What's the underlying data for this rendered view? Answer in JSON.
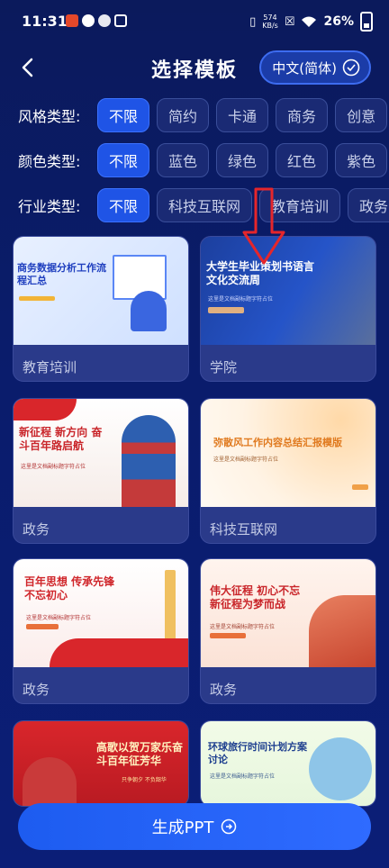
{
  "status": {
    "time": "11:31",
    "net_speed_value": "574",
    "net_speed_unit": "KB/s",
    "battery": "26%"
  },
  "header": {
    "title": "选择模板",
    "language": "中文(简体)"
  },
  "filters": [
    {
      "label": "风格类型:",
      "options": [
        "不限",
        "简约",
        "卡通",
        "商务",
        "创意"
      ],
      "selected": "不限"
    },
    {
      "label": "颜色类型:",
      "options": [
        "不限",
        "蓝色",
        "绿色",
        "红色",
        "紫色"
      ],
      "selected": "不限"
    },
    {
      "label": "行业类型:",
      "options": [
        "不限",
        "科技互联网",
        "教育培训",
        "政务"
      ],
      "selected": "不限"
    }
  ],
  "templates": [
    {
      "category": "教育培训",
      "title": "商务数据分析工作流程汇总",
      "subtitle": "",
      "tag": ""
    },
    {
      "category": "学院",
      "title": "大学生毕业策划书语言文化交流周",
      "subtitle": "这里是文档副标题字符占位",
      "tag": ""
    },
    {
      "category": "政务",
      "title": "新征程 新方向 奋斗百年路启航",
      "subtitle": "这里是文档副标题字符占位",
      "tag": ""
    },
    {
      "category": "科技互联网",
      "title": "弥散风工作内容总结汇报模版",
      "subtitle": "这里是文档副标题字符占位",
      "tag": ""
    },
    {
      "category": "政务",
      "title": "百年思想 传承先锋不忘初心",
      "subtitle": "这里是文档副标题字符占位",
      "tag": ""
    },
    {
      "category": "政务",
      "title": "伟大征程 初心不忘新征程为梦而战",
      "subtitle": "这里是文档副标题字符占位",
      "tag": ""
    },
    {
      "category": "",
      "title": "高歌以贺万家乐奋斗百年征芳华",
      "subtitle": "只争朝夕 不负韶华",
      "tag": ""
    },
    {
      "category": "",
      "title": "环球旅行时间计划方案讨论",
      "subtitle": "这里是文档副标题字符占位",
      "tag": ""
    }
  ],
  "button": {
    "label": "生成PPT"
  },
  "colors": {
    "background": "#0b1a5c",
    "accent": "#1f54e6",
    "annotation_arrow": "#e5262b"
  }
}
